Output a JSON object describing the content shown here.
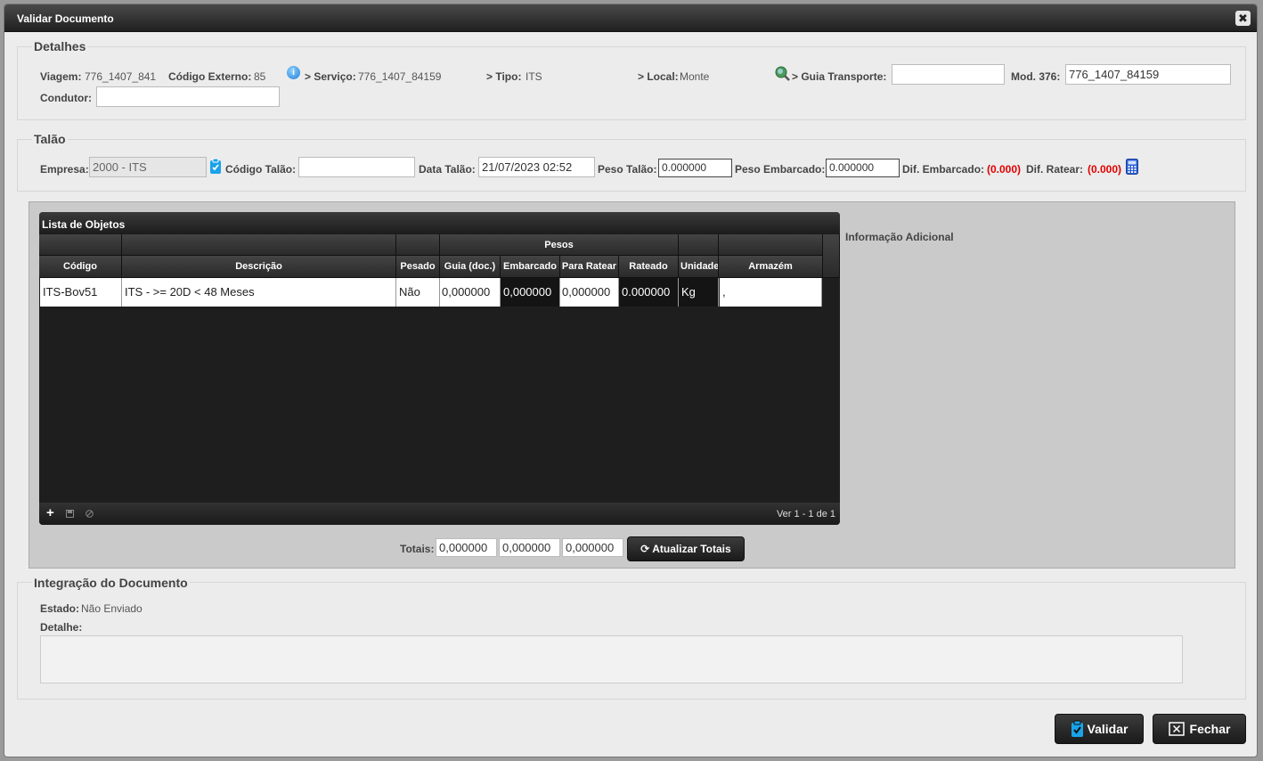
{
  "window": {
    "title": "Validar Documento",
    "close_label": "✖"
  },
  "detalhes": {
    "legend": "Detalhes",
    "viagem_label": "Viagem:",
    "viagem_value": "776_1407_841",
    "codigo_externo_label": "Código Externo:",
    "codigo_externo_value": "85",
    "servico_label": "> Serviço:",
    "servico_value": "776_1407_84159",
    "tipo_label": "> Tipo:",
    "tipo_value": "ITS",
    "local_label": "> Local:",
    "local_value": "Monte",
    "guia_label": "> Guia Transporte:",
    "guia_value": "",
    "mod376_label": "Mod. 376:",
    "mod376_value": "776_1407_84159",
    "condutor_label": "Condutor:",
    "condutor_value": ""
  },
  "talao": {
    "legend": "Talão",
    "empresa_label": "Empresa:",
    "empresa_value": "2000 - ITS",
    "codigo_label": "Código Talão:",
    "codigo_value": "",
    "data_label": "Data Talão:",
    "data_value": "21/07/2023 02:52",
    "peso_talao_label": "Peso Talão:",
    "peso_talao_value": "0.000000",
    "peso_embarcado_label": "Peso Embarcado:",
    "peso_embarcado_value": "0.000000",
    "dif_embarcado_label": "Dif. Embarcado:",
    "dif_embarcado_value": "(0.000)",
    "dif_ratear_label": "Dif. Ratear:",
    "dif_ratear_value": "(0.000)"
  },
  "grid": {
    "title": "Lista de Objetos",
    "group_header": "Pesos",
    "columns": [
      "Código",
      "Descrição",
      "Pesado",
      "Guia (doc.)",
      "Embarcado",
      "Para Ratear",
      "Rateado",
      "Unidade",
      "Armazém"
    ],
    "rows": [
      {
        "codigo": "ITS-Bov51",
        "descricao": "ITS -   >= 20D < 48 Meses",
        "pesado": "Não",
        "guia": "0,000000",
        "embarcado": "0,000000",
        "para_ratear": "0,000000",
        "rateado": "0.000000",
        "unidade": "Kg",
        "armazem": ","
      }
    ],
    "pager": "Ver 1 - 1 de 1",
    "add_icon": "plus-icon",
    "save_icon": "disk-icon",
    "cancel_icon": "cancel-icon"
  },
  "info_adicional_label": "Informação Adicional",
  "totais": {
    "label": "Totais:",
    "values": [
      "0,000000",
      "0,000000",
      "0,000000"
    ],
    "refresh_label": "Atualizar Totais"
  },
  "integracao": {
    "legend": "Integração do Documento",
    "estado_label": "Estado:",
    "estado_value": "Não Enviado",
    "detalhe_label": "Detalhe:",
    "detalhe_value": ""
  },
  "buttons": {
    "validar": "Validar",
    "fechar": "Fechar"
  },
  "colors": {
    "accent_red": "#e00000",
    "info_blue": "#1f7fd6",
    "validar_icon": "#1aa3e8"
  }
}
